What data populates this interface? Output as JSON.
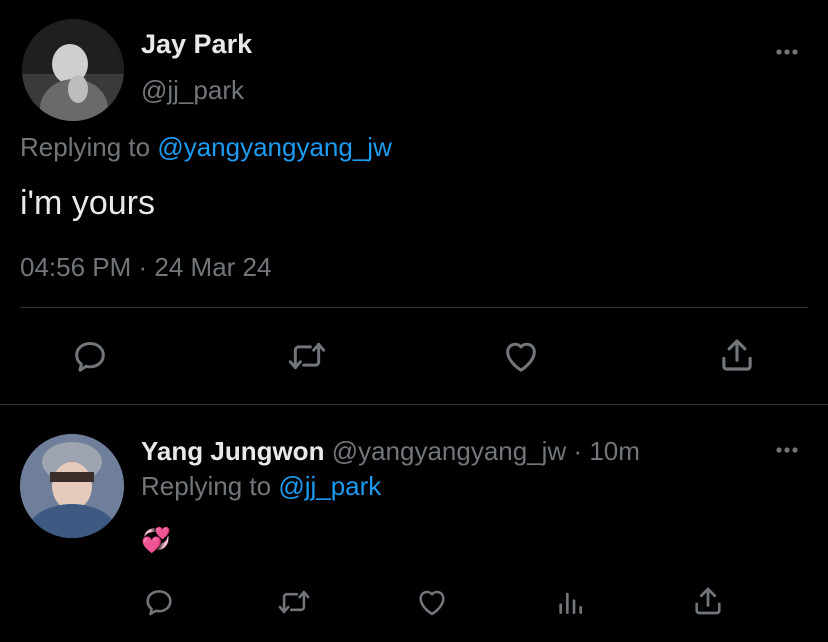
{
  "main_tweet": {
    "author_name": "Jay Park",
    "handle": "@jj_park",
    "replying_prefix": "Replying to",
    "replying_to": "@yangyangyang_jw",
    "text": "i'm yours",
    "timestamp": "04:56 PM · 24 Mar 24",
    "more_icon": "more-horizontal-icon",
    "actions": [
      "reply-icon",
      "retweet-icon",
      "like-icon",
      "share-icon"
    ]
  },
  "reply_tweet": {
    "author_name": "Yang Jungwon",
    "handle_time": "@yangyangyang_jw · 10m",
    "replying_prefix": "Replying to",
    "replying_to": "@jj_park",
    "emoji": "💞",
    "more_icon": "more-horizontal-icon",
    "actions": [
      "reply-icon",
      "retweet-icon",
      "like-icon",
      "analytics-icon",
      "share-icon"
    ]
  },
  "colors": {
    "background": "#000000",
    "text": "#e7e9ea",
    "muted": "#71767b",
    "link": "#1d9bf0",
    "divider": "#2f3336"
  }
}
